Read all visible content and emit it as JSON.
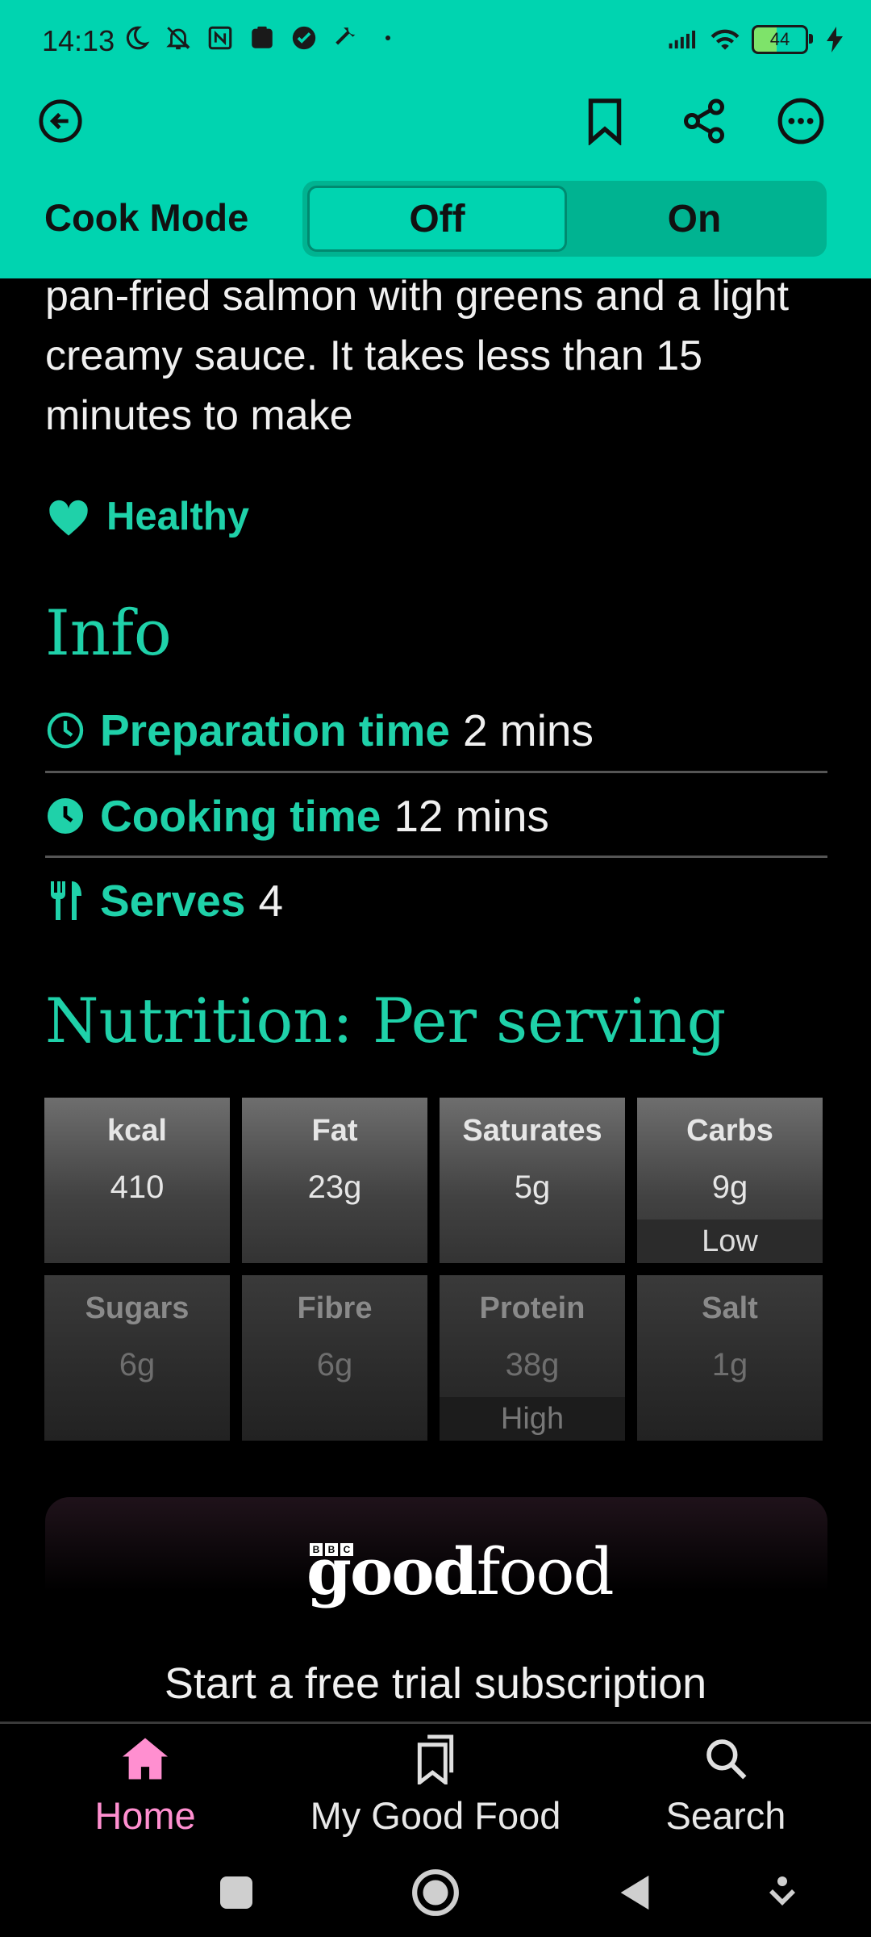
{
  "status_bar": {
    "time": "14:13",
    "battery": "44"
  },
  "header": {
    "cook_mode_label": "Cook Mode",
    "toggle_off": "Off",
    "toggle_on": "On",
    "selected": "Off"
  },
  "content": {
    "description": "pan-fried salmon with greens and a light creamy sauce. It takes less than 15 minutes to make",
    "tag": "Healthy",
    "info_heading": "Info",
    "info": [
      {
        "icon": "clock-outline-icon",
        "label": "Preparation time",
        "value": "2 mins"
      },
      {
        "icon": "clock-filled-icon",
        "label": "Cooking time",
        "value": "12 mins"
      },
      {
        "icon": "cutlery-icon",
        "label": "Serves",
        "value": "4"
      }
    ],
    "nutrition_heading": "Nutrition: Per serving",
    "nutrition": [
      {
        "label": "kcal",
        "value": "410",
        "badge": ""
      },
      {
        "label": "Fat",
        "value": "23g",
        "badge": ""
      },
      {
        "label": "Saturates",
        "value": "5g",
        "badge": ""
      },
      {
        "label": "Carbs",
        "value": "9g",
        "badge": "Low"
      },
      {
        "label": "Sugars",
        "value": "6g",
        "badge": ""
      },
      {
        "label": "Fibre",
        "value": "6g",
        "badge": ""
      },
      {
        "label": "Protein",
        "value": "38g",
        "badge": "High"
      },
      {
        "label": "Salt",
        "value": "1g",
        "badge": ""
      }
    ]
  },
  "promo": {
    "logo_bbc": [
      "B",
      "B",
      "C"
    ],
    "logo_good": "good",
    "logo_food": "food",
    "text": "Start a free trial subscription"
  },
  "bottom_nav": {
    "items": [
      {
        "label": "Home",
        "icon": "home-icon",
        "active": true
      },
      {
        "label": "My Good Food",
        "icon": "bookmarks-icon",
        "active": false
      },
      {
        "label": "Search",
        "icon": "search-icon",
        "active": false
      }
    ]
  },
  "colors": {
    "accent": "#00D4B0",
    "accent_text": "#1FD1A9",
    "nav_active": "#FF8FD0"
  }
}
